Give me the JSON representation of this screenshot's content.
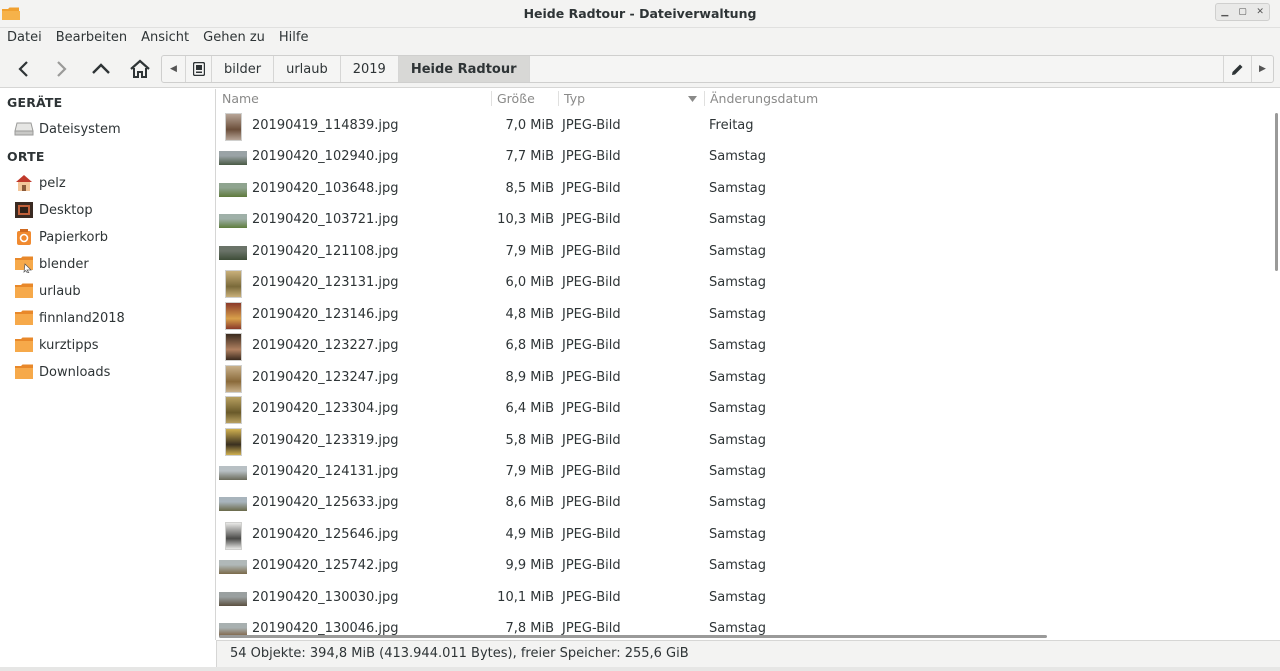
{
  "window": {
    "title": "Heide Radtour - Dateiverwaltung",
    "app_icon": "folder-icon",
    "controls": [
      "minimize-icon",
      "maximize-icon",
      "close-icon"
    ]
  },
  "menubar": {
    "items": [
      "Datei",
      "Bearbeiten",
      "Ansicht",
      "Gehen zu",
      "Hilfe"
    ]
  },
  "toolbar": {
    "buttons": [
      "back-icon",
      "forward-icon",
      "up-icon",
      "home-icon"
    ],
    "breadcrumbs": [
      "bilder",
      "urlaub",
      "2019",
      "Heide Radtour"
    ],
    "active_crumb": "Heide Radtour"
  },
  "sidebar": {
    "devices_header": "GERÄTE",
    "devices": [
      {
        "label": "Dateisystem",
        "icon": "drive-icon"
      }
    ],
    "places_header": "ORTE",
    "places": [
      {
        "label": "pelz",
        "icon": "home-folder-icon"
      },
      {
        "label": "Desktop",
        "icon": "desktop-icon"
      },
      {
        "label": "Papierkorb",
        "icon": "trash-icon"
      },
      {
        "label": "blender",
        "icon": "folder-link-icon"
      },
      {
        "label": "urlaub",
        "icon": "folder-icon"
      },
      {
        "label": "finnland2018",
        "icon": "folder-icon"
      },
      {
        "label": "kurztipps",
        "icon": "folder-icon"
      },
      {
        "label": "Downloads",
        "icon": "folder-icon"
      }
    ]
  },
  "filelist": {
    "columns": {
      "name": "Name",
      "size": "Größe",
      "type": "Typ",
      "date": "Änderungsdatum"
    },
    "sort_column": "Typ",
    "files": [
      {
        "name": "20190419_114839.jpg",
        "size": "7,0 MiB",
        "type": "JPEG-Bild",
        "date": "Freitag",
        "orient": "portrait",
        "colors": [
          "#b7a597",
          "#6b4e3a"
        ]
      },
      {
        "name": "20190420_102940.jpg",
        "size": "7,7 MiB",
        "type": "JPEG-Bild",
        "date": "Samstag",
        "orient": "landscape",
        "colors": [
          "#9aa3a6",
          "#4a5a45"
        ]
      },
      {
        "name": "20190420_103648.jpg",
        "size": "8,5 MiB",
        "type": "JPEG-Bild",
        "date": "Samstag",
        "orient": "landscape",
        "colors": [
          "#8fa48f",
          "#5f7a3c"
        ]
      },
      {
        "name": "20190420_103721.jpg",
        "size": "10,3 MiB",
        "type": "JPEG-Bild",
        "date": "Samstag",
        "orient": "landscape",
        "colors": [
          "#9fb0a8",
          "#5e7d3d"
        ]
      },
      {
        "name": "20190420_121108.jpg",
        "size": "7,9 MiB",
        "type": "JPEG-Bild",
        "date": "Samstag",
        "orient": "landscape",
        "colors": [
          "#6a7368",
          "#3e4d38"
        ]
      },
      {
        "name": "20190420_123131.jpg",
        "size": "6,0 MiB",
        "type": "JPEG-Bild",
        "date": "Samstag",
        "orient": "portrait",
        "colors": [
          "#c9b07a",
          "#7a6a3a"
        ]
      },
      {
        "name": "20190420_123146.jpg",
        "size": "4,8 MiB",
        "type": "JPEG-Bild",
        "date": "Samstag",
        "orient": "portrait",
        "colors": [
          "#8a3a2a",
          "#d8a04a"
        ]
      },
      {
        "name": "20190420_123227.jpg",
        "size": "6,8 MiB",
        "type": "JPEG-Bild",
        "date": "Samstag",
        "orient": "portrait",
        "colors": [
          "#3a2a1e",
          "#b08060"
        ]
      },
      {
        "name": "20190420_123247.jpg",
        "size": "8,9 MiB",
        "type": "JPEG-Bild",
        "date": "Samstag",
        "orient": "portrait",
        "colors": [
          "#c8b08a",
          "#8a6a3a"
        ]
      },
      {
        "name": "20190420_123304.jpg",
        "size": "6,4 MiB",
        "type": "JPEG-Bild",
        "date": "Samstag",
        "orient": "portrait",
        "colors": [
          "#b8a060",
          "#6a5a2a"
        ]
      },
      {
        "name": "20190420_123319.jpg",
        "size": "5,8 MiB",
        "type": "JPEG-Bild",
        "date": "Samstag",
        "orient": "portrait",
        "colors": [
          "#d0b050",
          "#3a3020"
        ]
      },
      {
        "name": "20190420_124131.jpg",
        "size": "7,9 MiB",
        "type": "JPEG-Bild",
        "date": "Samstag",
        "orient": "landscape",
        "colors": [
          "#b8c0c4",
          "#6a6a5a"
        ]
      },
      {
        "name": "20190420_125633.jpg",
        "size": "8,6 MiB",
        "type": "JPEG-Bild",
        "date": "Samstag",
        "orient": "landscape",
        "colors": [
          "#a8b4bc",
          "#6a6a4a"
        ]
      },
      {
        "name": "20190420_125646.jpg",
        "size": "4,9 MiB",
        "type": "JPEG-Bild",
        "date": "Samstag",
        "orient": "portrait",
        "colors": [
          "#e8e8e6",
          "#4a4a48"
        ]
      },
      {
        "name": "20190420_125742.jpg",
        "size": "9,9 MiB",
        "type": "JPEG-Bild",
        "date": "Samstag",
        "orient": "landscape",
        "colors": [
          "#b0b8b8",
          "#7a6a4a"
        ]
      },
      {
        "name": "20190420_130030.jpg",
        "size": "10,1 MiB",
        "type": "JPEG-Bild",
        "date": "Samstag",
        "orient": "landscape",
        "colors": [
          "#9aa0a0",
          "#5a5040"
        ]
      },
      {
        "name": "20190420_130046.jpg",
        "size": "7,8 MiB",
        "type": "JPEG-Bild",
        "date": "Samstag",
        "orient": "landscape",
        "colors": [
          "#a8b0b0",
          "#7a5a3a"
        ]
      }
    ]
  },
  "statusbar": {
    "text": "54 Objekte: 394,8 MiB (413.944.011 Bytes), freier Speicher: 255,6 GiB"
  }
}
